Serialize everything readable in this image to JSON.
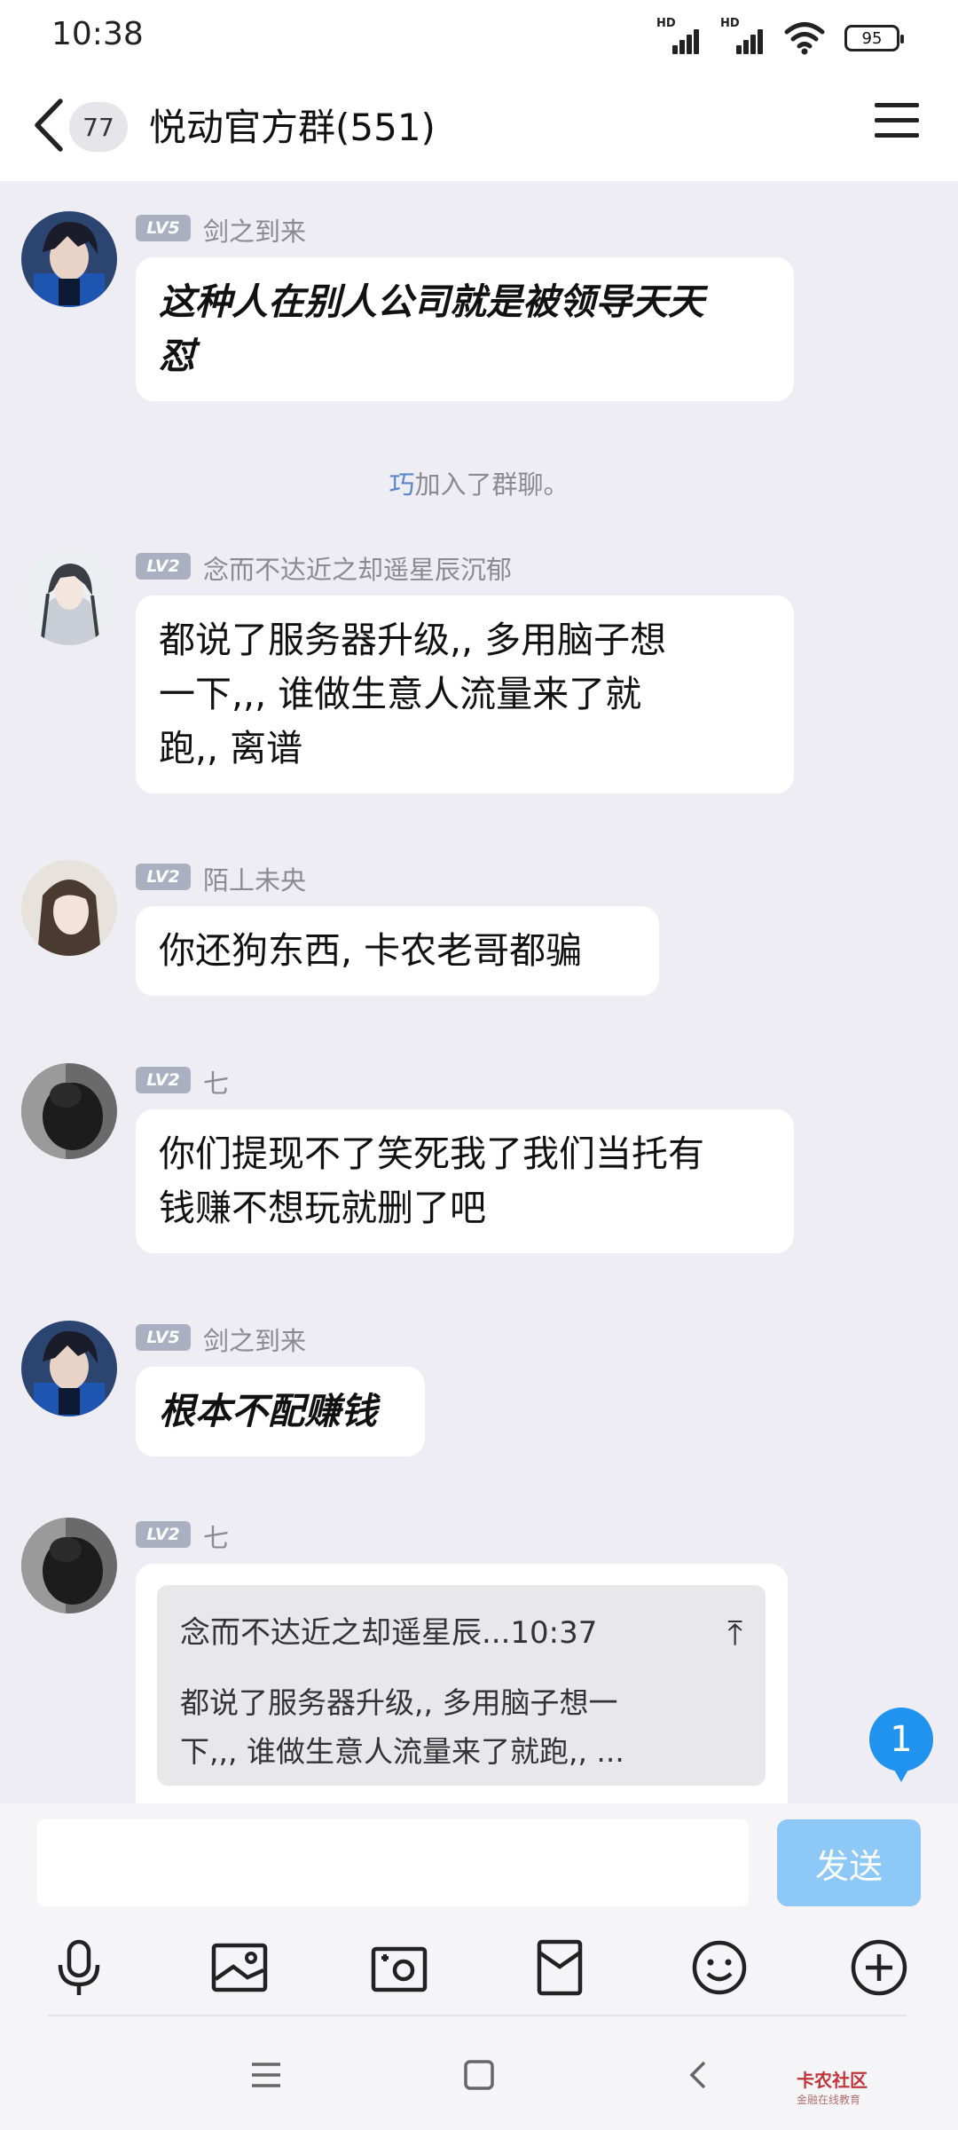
{
  "status": {
    "time": "10:38",
    "battery": "95",
    "hd": "HD"
  },
  "header": {
    "unread": "77",
    "title": "悦动官方群(551)"
  },
  "messages": [
    {
      "level": "LV5",
      "nick": "剑之到来",
      "lines": [
        "这种人在别人公司就是被领导天天",
        "怼"
      ]
    },
    {
      "level": "LV2",
      "nick": "念而不达近之却遥星辰沉郁",
      "lines": [
        "都说了服务器升级,, 多用脑子想",
        "一下,,, 谁做生意人流量来了就",
        "跑,, 离谱"
      ]
    },
    {
      "level": "LV2",
      "nick": "陌丄未央",
      "lines": [
        "你还狗东西, 卡农老哥都骗"
      ]
    },
    {
      "level": "LV2",
      "nick": "七",
      "lines": [
        "你们提现不了笑死我了我们当托有",
        "钱赚不想玩就删了吧"
      ]
    },
    {
      "level": "LV5",
      "nick": "剑之到来",
      "lines": [
        "根本不配赚钱"
      ]
    },
    {
      "level": "LV2",
      "nick": "七"
    }
  ],
  "system": {
    "who": "巧",
    "text": "加入了群聊。"
  },
  "quote": {
    "header": "念而不达近之却遥星辰...10:37",
    "lines": [
      "都说了服务器升级,, 多用脑子想一",
      "下,,, 谁做生意人流量来了就跑,, ..."
    ]
  },
  "badge": "1",
  "input": {
    "send": "发送"
  },
  "watermark": {
    "name": "卡农社区",
    "sub": "金融在线教育"
  }
}
